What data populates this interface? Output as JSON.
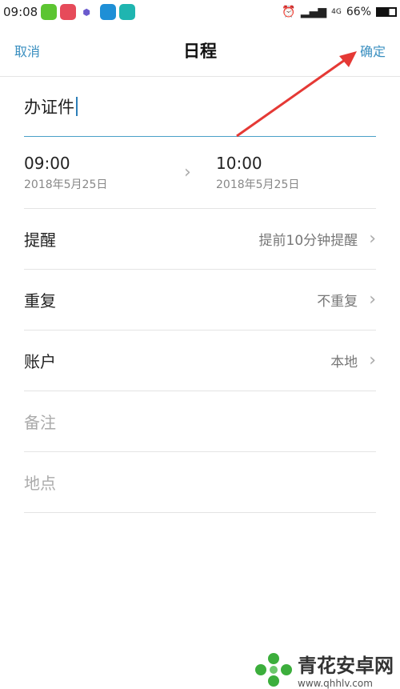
{
  "status_bar": {
    "time": "09:08",
    "network": "4G",
    "battery": "66%"
  },
  "nav": {
    "cancel": "取消",
    "title": "日程",
    "confirm": "确定"
  },
  "event": {
    "title": "办证件"
  },
  "start": {
    "time": "09:00",
    "date": "2018年5月25日"
  },
  "end": {
    "time": "10:00",
    "date": "2018年5月25日"
  },
  "rows": [
    {
      "label": "提醒",
      "value": "提前10分钟提醒"
    },
    {
      "label": "重复",
      "value": "不重复"
    },
    {
      "label": "账户",
      "value": "本地"
    }
  ],
  "placeholders": {
    "notes": "备注",
    "location": "地点"
  },
  "watermark": {
    "name": "青花安卓网",
    "url": "www.qhhlv.com"
  },
  "colors": {
    "accent": "#3a8fc0",
    "arrow": "#e53935"
  }
}
